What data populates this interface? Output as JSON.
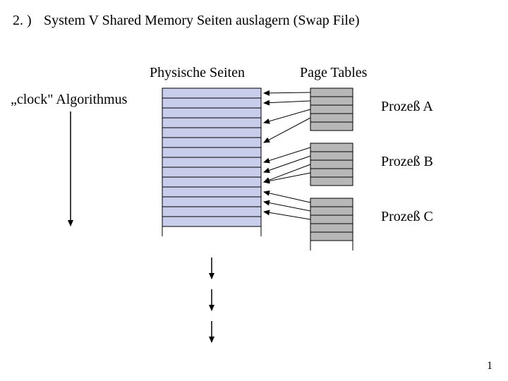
{
  "title_num": "2. )",
  "title_text": "System V Shared Memory Seiten auslagern (Swap File)",
  "labels": {
    "phys": "Physische Seiten",
    "page_tables": "Page Tables",
    "clock_algo": "„clock\" Algorithmus",
    "proc_a": "Prozeß A",
    "proc_b": "Prozeß B",
    "proc_c": "Prozeß C"
  },
  "page_number": "1",
  "diagram": {
    "physical_pages": 14,
    "page_tables": [
      {
        "name": "A",
        "rows": 5
      },
      {
        "name": "B",
        "rows": 5
      },
      {
        "name": "C",
        "rows": 5
      }
    ],
    "clock_arrow_down": true,
    "bottom_arrows_down": 3,
    "mapping_arrows_from_tables_to_physical": true
  }
}
